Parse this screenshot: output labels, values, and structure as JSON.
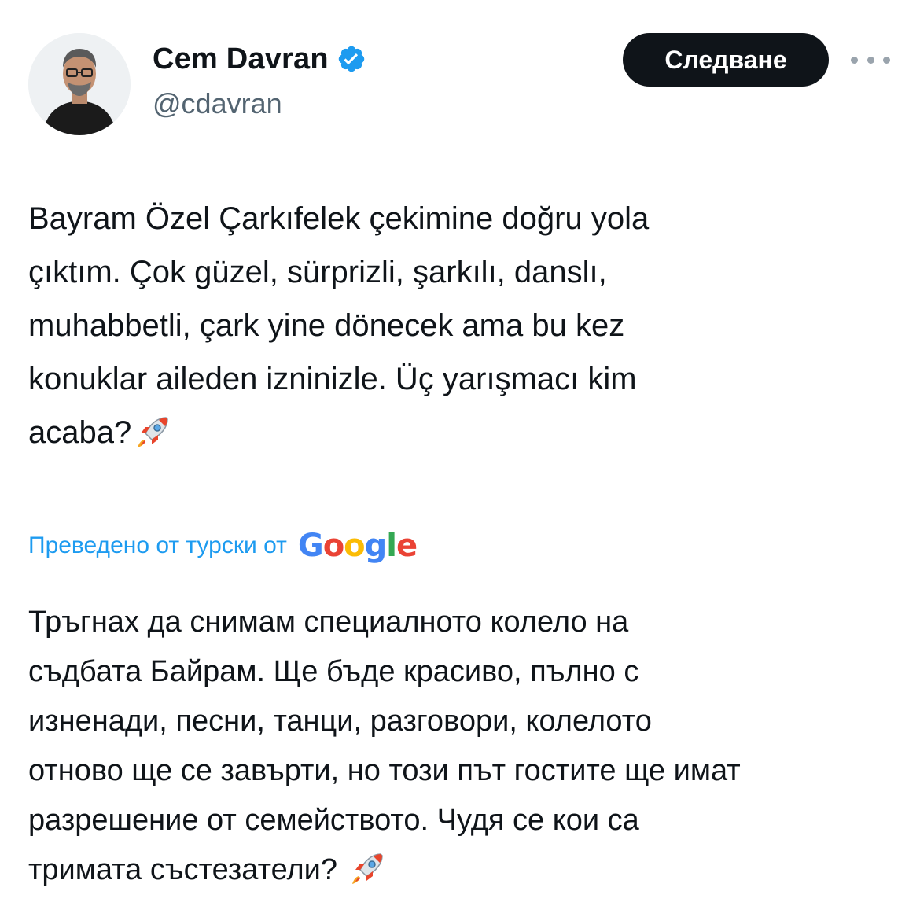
{
  "author": {
    "display_name": "Cem Davran",
    "handle": "@cdavran",
    "verified": true
  },
  "actions": {
    "follow_label": "Следване",
    "more_icon": "more-horizontal-icon"
  },
  "tweet": {
    "text": "Bayram Özel Çarkıfelek çekimine doğru yola\nçıktım. Çok güzel, sürprizli, şarkılı, danslı,\nmuhabbetli, çark yine dönecek ama bu kez\nkonuklar aileden izninizle. Üç yarışmacı kim\nacaba?",
    "trailing_emoji": "🚀"
  },
  "translation": {
    "label": "Преведено от турски от",
    "provider_logo_text": "Google",
    "text": "Тръгнах да снимам специалното колело на\nсъдбата Байрам. Ще бъде красиво, пълно с\nизненади, песни, танци, разговори, колелото\nотново ще се завърти, но този път гостите ще имат\nразрешение от семейството. Чудя се кои са\nтримата състезатели? ",
    "trailing_emoji": "🚀"
  },
  "colors": {
    "text_primary": "#0f1419",
    "text_secondary": "#536471",
    "link_blue": "#1d9bf0",
    "verified_blue": "#1d9bf0",
    "follow_bg": "#0f1419",
    "google_blue": "#4285f4",
    "google_red": "#ea4335",
    "google_yellow": "#fbbc05",
    "google_green": "#34a853"
  }
}
